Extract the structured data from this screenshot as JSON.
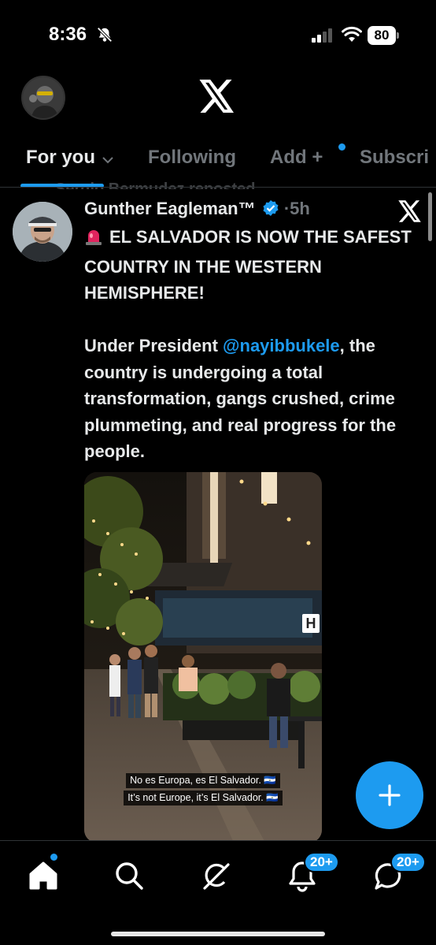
{
  "status_bar": {
    "time": "8:36",
    "battery": "80",
    "icons": [
      "bell-slash-icon",
      "cell-signal-icon",
      "wifi-icon",
      "battery-icon"
    ]
  },
  "header": {
    "logo": "X",
    "profile_avatar": "avatar-icon"
  },
  "tabs": [
    {
      "label": "For you",
      "active": true
    },
    {
      "label": "Following",
      "active": false
    },
    {
      "label": "Add +",
      "active": false,
      "has_dot": true
    },
    {
      "label": "Subscri",
      "active": false
    }
  ],
  "repost_notice": "Sergio Bermudez reposted",
  "tweet": {
    "author": "Gunther Eagleman™",
    "verified": true,
    "time": "5h",
    "separator": "·",
    "headline": "EL SALVADOR IS NOW THE SAFEST COUNTRY IN THE WESTERN HEMISPHERE!",
    "body_prefix": "Under President ",
    "mention": "@nayibbukele",
    "body_suffix": ", the country is undergoing a total transformation, gangs crushed, crime plummeting, and real progress for the people.",
    "media": {
      "subtitle_es": "No es Europa, es El Salvador. 🇸🇻",
      "subtitle_en": "It’s not Europe, it’s El Salvador. 🇸🇻",
      "sign_letter": "H"
    }
  },
  "fab": {
    "icon": "plus-icon"
  },
  "bottom_nav": {
    "items": [
      "home-icon",
      "search-icon",
      "grok-icon",
      "bell-icon",
      "messages-icon"
    ],
    "notif_badge": "20+",
    "msg_badge": "20+"
  },
  "colors": {
    "accent": "#1d9bf0",
    "background": "#000000",
    "text": "#e7e9ea",
    "muted": "#71767b"
  }
}
